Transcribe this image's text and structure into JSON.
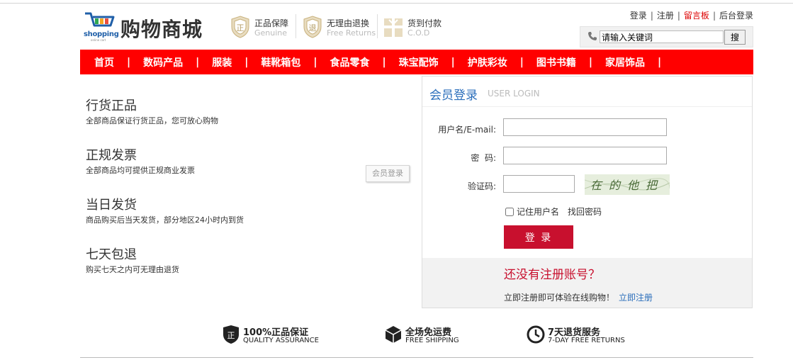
{
  "brand": {
    "logo_word": "shopping",
    "logo_sub": "online cart",
    "title": "购物商城"
  },
  "header_badges": [
    {
      "title": "正品保障",
      "en": "Genuine",
      "icon": "shield-zheng-icon",
      "glyph": "正"
    },
    {
      "title": "无理由退换",
      "en": "Free Returns",
      "icon": "shield-tui-icon",
      "glyph": "退"
    },
    {
      "title": "货到付款",
      "en": "C.O.D",
      "icon": "gift-box-icon",
      "glyph": ""
    }
  ],
  "top_links": [
    {
      "label": "登录",
      "highlight": false
    },
    {
      "label": "注册",
      "highlight": false
    },
    {
      "label": "留言板",
      "highlight": true
    },
    {
      "label": "后台登录",
      "highlight": false
    }
  ],
  "top_links_sep": "|",
  "search": {
    "value": "请输入关键词",
    "button": "搜"
  },
  "nav": {
    "items": [
      "首页",
      "数码产品",
      "服装",
      "鞋靴箱包",
      "食品零食",
      "珠宝配饰",
      "护肤彩妆",
      "图书书籍",
      "家居饰品"
    ],
    "separator": "|"
  },
  "features": [
    {
      "title": "行货正品",
      "desc": "全部商品保证行货正品，您可放心购物"
    },
    {
      "title": "正规发票",
      "desc": "全部商品均可提供正规商业发票"
    },
    {
      "title": "当日发货",
      "desc": "商品购买后当天发货，部分地区24小时内到货"
    },
    {
      "title": "七天包退",
      "desc": "购买七天之内可无理由退货"
    }
  ],
  "float_tag": "会员登录",
  "login": {
    "title": "会员登录",
    "title_en": "USER LOGIN",
    "username_label": "用户名/E-mail:",
    "username_value": "",
    "password_label": "密  码:",
    "password_value": "",
    "captcha_label": "验证码:",
    "captcha_value": "",
    "captcha_text": "在的他把",
    "remember_label": "记住用户名",
    "remember_checked": false,
    "forgot_label": "找回密码",
    "submit_label": "登 录",
    "register_question": "还没有注册账号？",
    "register_note": "立即注册即可体验在线购物！",
    "register_link": "立即注册"
  },
  "services": [
    {
      "title": "100%正品保证",
      "en": "QUALITY ASSURANCE",
      "icon": "shield-quality-icon"
    },
    {
      "title": "全场免运费",
      "en": "FREE SHIPPING",
      "icon": "box-shipping-icon"
    },
    {
      "title": "7天退货服务",
      "en": "7-DAY FREE RETURNS",
      "icon": "clock-return-icon"
    }
  ],
  "colors": {
    "nav_bg": "#ff0000",
    "accent_red": "#c8102e",
    "link_blue": "#2a6ebb",
    "logo_blue": "#1f5fa8"
  }
}
